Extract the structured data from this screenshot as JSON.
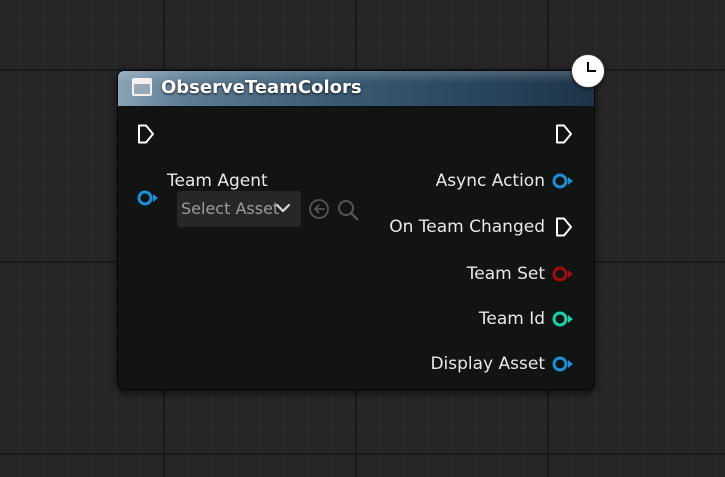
{
  "node": {
    "title": "ObserveTeamColors",
    "latent_icon": "clock-icon"
  },
  "inputs": {
    "team_agent_label": "Team Agent",
    "asset_picker": {
      "selected_value": "Select Asset"
    }
  },
  "outputs": [
    {
      "label": "Async Action",
      "pin_type": "object",
      "color": "#1a8fd6"
    },
    {
      "label": "On Team Changed",
      "pin_type": "exec",
      "color": "#ffffff"
    },
    {
      "label": "Team Set",
      "pin_type": "bool",
      "color": "#a10c0c"
    },
    {
      "label": "Team Id",
      "pin_type": "int",
      "color": "#1ed0a8"
    },
    {
      "label": "Display Asset",
      "pin_type": "object",
      "color": "#1a8fd6"
    }
  ],
  "colors": {
    "object_pin": "#1a8fd6",
    "bool_pin": "#a10c0c",
    "int_pin": "#1ed0a8",
    "exec_pin": "#ffffff",
    "header_start": "#8aa2b6",
    "header_end": "#1d3448"
  }
}
